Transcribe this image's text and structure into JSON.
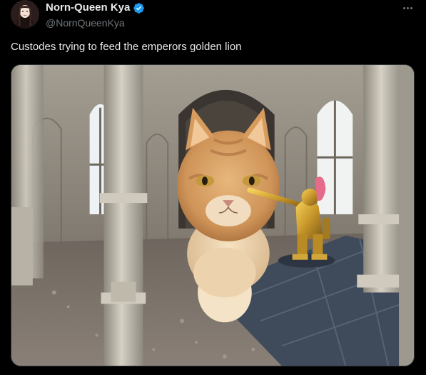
{
  "post": {
    "author": {
      "display_name": "Norn-Queen Kya",
      "handle": "@NornQueenKya",
      "verified": true,
      "verified_icon": "verified-badge-icon",
      "verified_color": "#1d9bf0"
    },
    "more_icon": "more-dots-icon",
    "text": "Custodes trying to feed the emperors golden lion",
    "media": {
      "type": "photo"
    }
  },
  "colors": {
    "background": "#000000",
    "text_primary": "#e7e9ea",
    "text_secondary": "#71767b",
    "border": "#2f3336"
  }
}
